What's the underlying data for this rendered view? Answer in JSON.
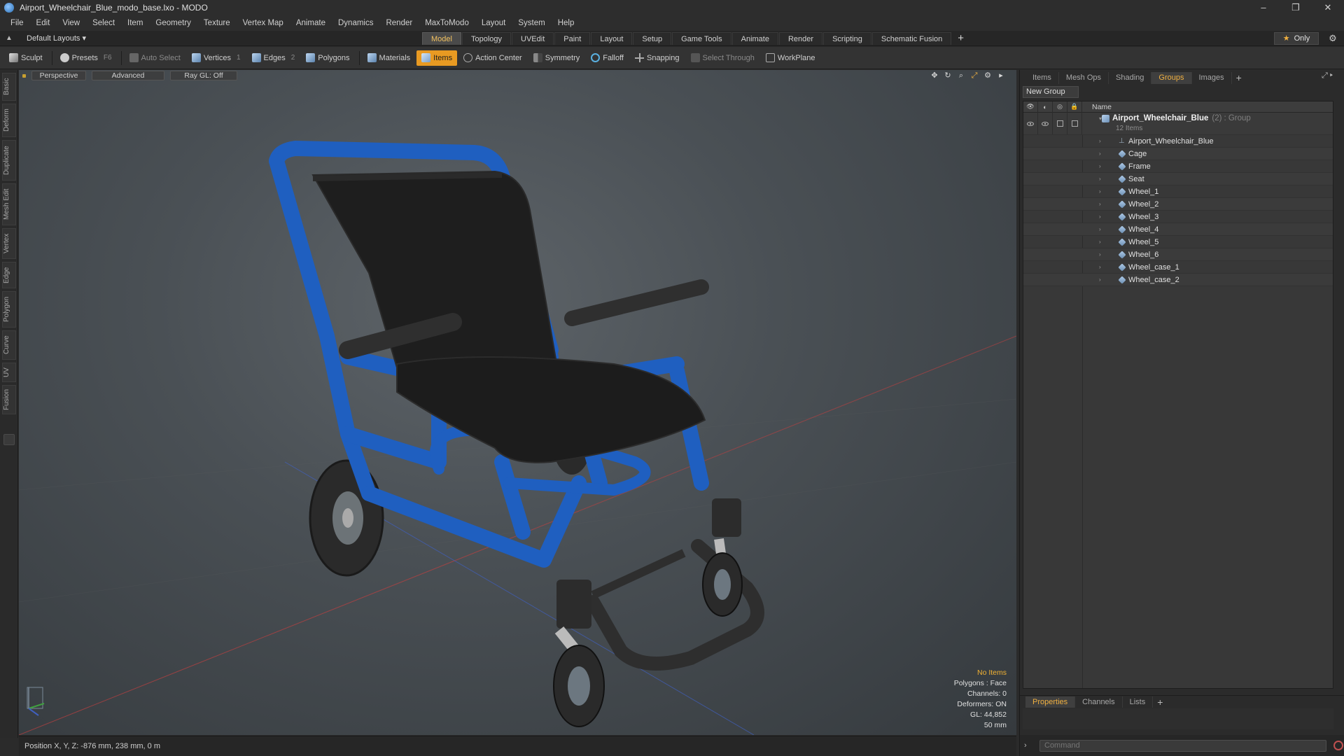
{
  "window": {
    "title": "Airport_Wheelchair_Blue_modo_base.lxo - MODO",
    "buttons": {
      "minimize": "–",
      "restore": "❐",
      "close": "✕"
    }
  },
  "menu": [
    "File",
    "Edit",
    "View",
    "Select",
    "Item",
    "Geometry",
    "Texture",
    "Vertex Map",
    "Animate",
    "Dynamics",
    "Render",
    "MaxToModo",
    "Layout",
    "System",
    "Help"
  ],
  "layout_bar": {
    "layouts_label": "Default Layouts ▾",
    "tabs": [
      "Model",
      "Topology",
      "UVEdit",
      "Paint",
      "Layout",
      "Setup",
      "Game Tools",
      "Animate",
      "Render",
      "Scripting",
      "Schematic Fusion"
    ],
    "active_tab": "Model",
    "add_symbol": "+",
    "only_label": "Only"
  },
  "toolbar": {
    "sculpt": "Sculpt",
    "presets": "Presets",
    "presets_key": "F6",
    "auto_select": "Auto Select",
    "vertices": "Vertices",
    "vertices_key": "1",
    "edges": "Edges",
    "edges_key": "2",
    "polygons": "Polygons",
    "materials": "Materials",
    "items": "Items",
    "action_center": "Action Center",
    "symmetry": "Symmetry",
    "falloff": "Falloff",
    "snapping": "Snapping",
    "select_through": "Select Through",
    "workplane": "WorkPlane"
  },
  "left_tabs": [
    "Basic",
    "Deform",
    "Duplicate",
    "Mesh Edit",
    "Vertex",
    "Edge",
    "Polygon",
    "Curve",
    "UV",
    "Fusion"
  ],
  "viewport": {
    "view_mode": "Perspective",
    "shading": "Advanced",
    "raygl": "Ray GL: Off",
    "info": {
      "selection": "No Items",
      "polygons": "Polygons : Face",
      "channels": "Channels: 0",
      "deformers": "Deformers: ON",
      "gl": "GL: 44,852",
      "units": "50 mm"
    }
  },
  "statusbar": {
    "position": "Position X, Y, Z:  -876 mm, 238 mm, 0 m"
  },
  "right_panel": {
    "tabs": [
      "Items",
      "Mesh Ops",
      "Shading",
      "Groups",
      "Images"
    ],
    "active_tab": "Groups",
    "new_group": "New Group",
    "name_header": "Name",
    "group": {
      "name": "Airport_Wheelchair_Blue",
      "count": "(2)",
      "type": ": Group",
      "subtitle": "12 Items"
    },
    "items": [
      "Airport_Wheelchair_Blue",
      "Cage",
      "Frame",
      "Seat",
      "Wheel_1",
      "Wheel_2",
      "Wheel_3",
      "Wheel_4",
      "Wheel_5",
      "Wheel_6",
      "Wheel_case_1",
      "Wheel_case_2"
    ],
    "bottom_tabs": [
      "Properties",
      "Channels",
      "Lists"
    ],
    "bottom_active": "Properties",
    "command_placeholder": "Command"
  },
  "colors": {
    "accent": "#e89a22",
    "frame_blue": "#1f5fc0",
    "seat_black": "#1e1e1e"
  }
}
